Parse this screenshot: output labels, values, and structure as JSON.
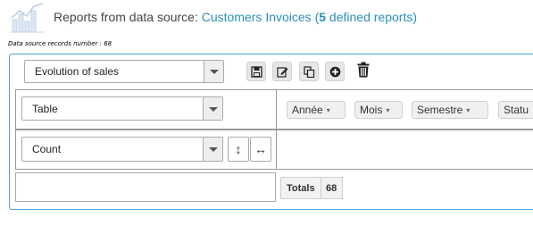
{
  "header": {
    "title_prefix": "Reports from data source: ",
    "source_name": "Customers Invoices",
    "paren_open": " (",
    "report_count": "5",
    "count_suffix": " defined reports)"
  },
  "records_label": "Data source records number : 68",
  "report_select": {
    "value": "Evolution of sales"
  },
  "toolbar": {
    "buttons": [
      "save-icon",
      "edit-icon",
      "copy-icon",
      "add-icon",
      "trash-icon"
    ]
  },
  "renderer_select": {
    "value": "Table"
  },
  "aggregator_select": {
    "value": "Count"
  },
  "sort_buttons": {
    "row_order": "↕",
    "col_order": "↔"
  },
  "column_fields": [
    {
      "label": "Année",
      "caret": "▾"
    },
    {
      "label": "Mois",
      "caret": "▾"
    },
    {
      "label": "Semestre",
      "caret": "▾"
    },
    {
      "label": "Statu",
      "caret": ""
    }
  ],
  "totals": {
    "label": "Totals",
    "value": "68"
  },
  "colors": {
    "accent": "#2a8fbd",
    "panel_border": "#4aa8d8"
  }
}
